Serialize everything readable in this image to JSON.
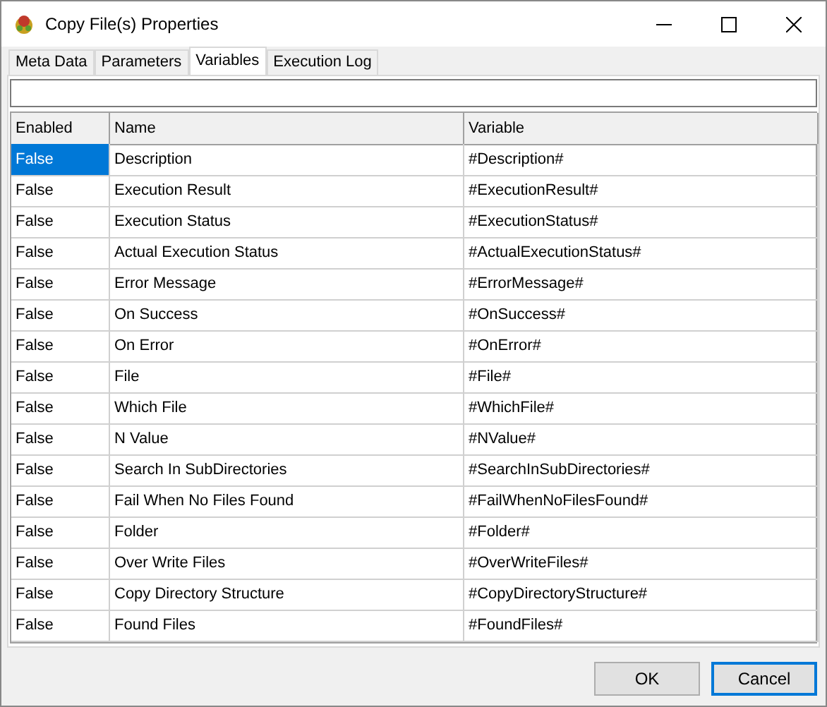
{
  "window": {
    "title": "Copy File(s) Properties"
  },
  "tabs": [
    {
      "label": "Meta Data",
      "selected": false
    },
    {
      "label": "Parameters",
      "selected": false
    },
    {
      "label": "Variables",
      "selected": true
    },
    {
      "label": "Execution Log",
      "selected": false
    }
  ],
  "table": {
    "columns": [
      "Enabled",
      "Name",
      "Variable"
    ],
    "rows": [
      {
        "enabled": "False",
        "name": "Description",
        "variable": "#Description#",
        "selected": true
      },
      {
        "enabled": "False",
        "name": "Execution Result",
        "variable": "#ExecutionResult#",
        "selected": false
      },
      {
        "enabled": "False",
        "name": "Execution Status",
        "variable": "#ExecutionStatus#",
        "selected": false
      },
      {
        "enabled": "False",
        "name": "Actual Execution Status",
        "variable": "#ActualExecutionStatus#",
        "selected": false
      },
      {
        "enabled": "False",
        "name": "Error Message",
        "variable": "#ErrorMessage#",
        "selected": false
      },
      {
        "enabled": "False",
        "name": "On Success",
        "variable": "#OnSuccess#",
        "selected": false
      },
      {
        "enabled": "False",
        "name": "On Error",
        "variable": "#OnError#",
        "selected": false
      },
      {
        "enabled": "False",
        "name": "File",
        "variable": "#File#",
        "selected": false
      },
      {
        "enabled": "False",
        "name": "Which File",
        "variable": "#WhichFile#",
        "selected": false
      },
      {
        "enabled": "False",
        "name": "N Value",
        "variable": "#NValue#",
        "selected": false
      },
      {
        "enabled": "False",
        "name": "Search In SubDirectories",
        "variable": "#SearchInSubDirectories#",
        "selected": false
      },
      {
        "enabled": "False",
        "name": "Fail When No Files Found",
        "variable": "#FailWhenNoFilesFound#",
        "selected": false
      },
      {
        "enabled": "False",
        "name": "Folder",
        "variable": "#Folder#",
        "selected": false
      },
      {
        "enabled": "False",
        "name": "Over Write Files",
        "variable": "#OverWriteFiles#",
        "selected": false
      },
      {
        "enabled": "False",
        "name": "Copy Directory Structure",
        "variable": "#CopyDirectoryStructure#",
        "selected": false
      },
      {
        "enabled": "False",
        "name": "Found Files",
        "variable": "#FoundFiles#",
        "selected": false
      }
    ]
  },
  "buttons": [
    {
      "label": "OK",
      "default": false
    },
    {
      "label": "Cancel",
      "default": true
    }
  ]
}
